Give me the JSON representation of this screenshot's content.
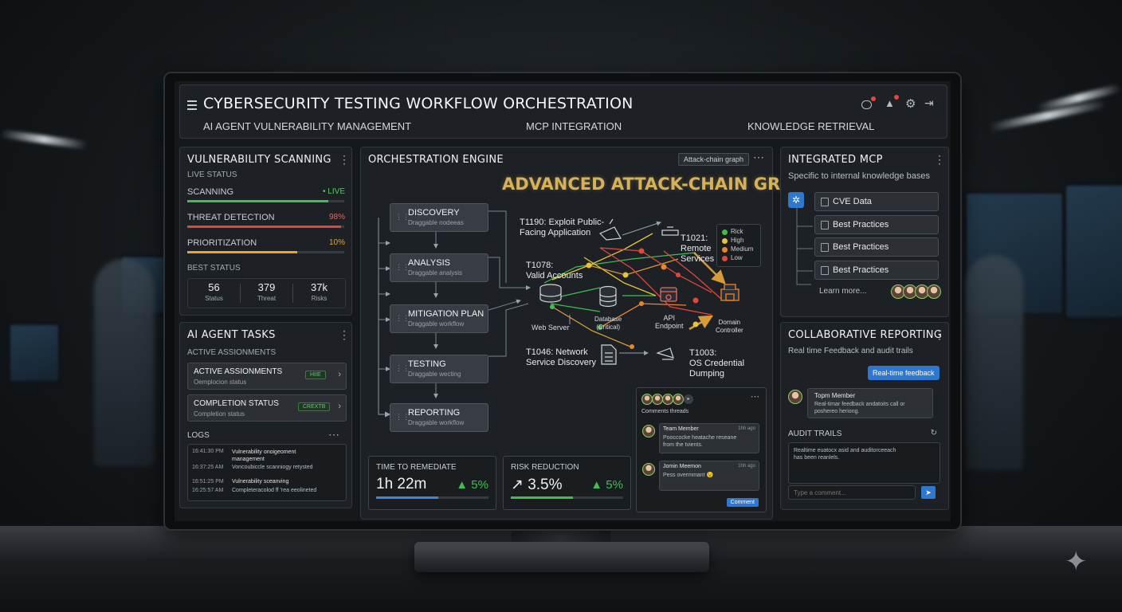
{
  "header": {
    "title": "CYBERSECURITY TESTING WORKFLOW ORCHESTRATION",
    "nav": [
      "AI AGENT VULNERABILITY MANAGEMENT",
      "MCP INTEGRATION",
      "KNOWLEDGE RETRIEVAL"
    ]
  },
  "vuln": {
    "title": "VULNERABILITY SCANNING",
    "live_status": "LIVE STATUS",
    "rows": [
      {
        "label": "SCANNING",
        "value": "• LIVE",
        "progress": 0.9,
        "color": "#3fbf4f"
      },
      {
        "label": "THREAT DETECTION",
        "value": "98%",
        "progress": 0.98,
        "color": "#e0483c"
      },
      {
        "label": "PRIORITIZATION",
        "value": "10%",
        "progress": 0.7,
        "color": "#e8a33a"
      }
    ],
    "best_status": "BEST STATUS",
    "stats": [
      {
        "value": "56",
        "label": "Status"
      },
      {
        "value": "379",
        "label": "Threat"
      },
      {
        "value": "37k",
        "label": "Risks"
      }
    ]
  },
  "tasks": {
    "title": "AI AGENT TASKS",
    "active": "ACTIVE ASSIONMENTS",
    "items": [
      {
        "title": "ACTIVE ASSIONMENTS",
        "sub": "Oemplocion status",
        "badge": "HIIE"
      },
      {
        "title": "COMPLETION STATUS",
        "sub": "Completion status",
        "badge": "CREXTB"
      }
    ],
    "logs_title": "LOGS",
    "logs": [
      {
        "time": "16:41:30 PM",
        "text": "Vulnerability onoigeoment management"
      },
      {
        "time": "16:37:25 AM",
        "text": "Voncoubiccle scanniogy retysted"
      },
      {
        "time": "16:51:25 PM",
        "text": "Vulnerability sceanving"
      },
      {
        "time": "16:25:57 AM",
        "text": "Completeracolod ff 'rea eeolineted"
      }
    ]
  },
  "orch": {
    "title": "ORCHESTRATION ENGINE",
    "tag": "Attack-chain graph",
    "headline": "ADVANCED ATTACK-CHAIN GRAPH",
    "nodes": [
      {
        "title": "DISCOVERY",
        "desc": "Draggable nodeeas"
      },
      {
        "title": "ANALYSIS",
        "desc": "Draggable analysis"
      },
      {
        "title": "MITIGATION PLAN",
        "desc": "Draggable workflow"
      },
      {
        "title": "TESTING",
        "desc": "Draggable wecting"
      },
      {
        "title": "REPORTING",
        "desc": "Draggable workflow"
      }
    ],
    "techniques": {
      "t1190": "T1190: Exploit Public-\nFacing Application",
      "t1078": "T1078:\nValid Accounts",
      "t1046": "T1046: Network\nService Discovery",
      "t1021": "T1021:\nRemote\nServices",
      "t1003": "T1003:\nOS Credential\nDumping"
    },
    "assets": {
      "web": "Web Server",
      "db": "Database\n(Critical)",
      "api": "API\nEndpoint",
      "dc": "Domain\nController"
    },
    "legend": [
      {
        "label": "Rick",
        "color": "#3fbf4f"
      },
      {
        "label": "High",
        "color": "#e8c23a"
      },
      {
        "label": "Medium",
        "color": "#e8862f"
      },
      {
        "label": "Low",
        "color": "#e0483c"
      }
    ],
    "metrics": [
      {
        "label": "TIME TO REMEDIATE",
        "value": "1h 22m",
        "delta": "▲ 5%",
        "progress": 0.55,
        "color": "#3a86e0"
      },
      {
        "label": "RISK REDUCTION",
        "value": "↗ 3.5%",
        "delta": "▲ 5%",
        "progress": 0.55,
        "color": "#3fbf4f"
      }
    ],
    "comments": {
      "title": "Comments threads",
      "items": [
        {
          "name": "Team Member",
          "time": "1hh ago",
          "text": "Pooccocke heatache reseane\nfrom the tvients."
        },
        {
          "name": "Jomin Meemon",
          "time": "1hh ago",
          "text": "Pess overmmant 😉"
        }
      ],
      "button": "Comment"
    }
  },
  "mcp": {
    "title": "INTEGRATED MCP",
    "subtitle": "Specific to internal knowledge bases",
    "items": [
      "CVE Data",
      "Best Practices",
      "Best Practices",
      "Best Practices"
    ],
    "learn_more": "Learn more..."
  },
  "collab": {
    "title": "COLLABORATIVE REPORTING",
    "subtitle": "Real time Feedback and audit trails",
    "bubble": "Real-time feedback",
    "member_name": "Topm Member",
    "member_text": "Real-timar feedback andatoits call or\nposhereo heriong.",
    "audit_title": "AUDIT TRAILS",
    "audit_text": "Realtime euatocx asid and auditorceeach\nhas been reanlels.",
    "placeholder": "Type a comment..."
  }
}
